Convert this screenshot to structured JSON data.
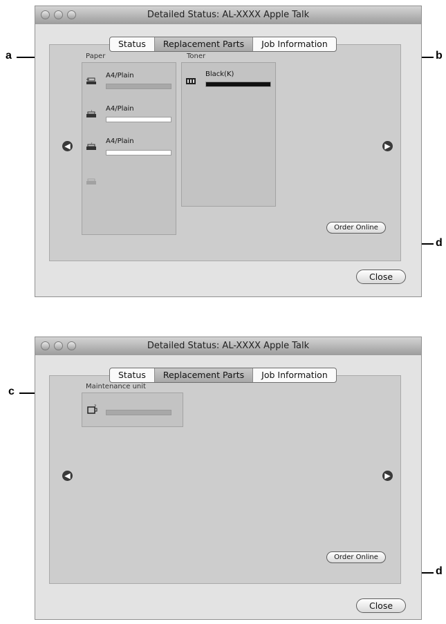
{
  "window1": {
    "title": "Detailed Status: AL-XXXX  Apple Talk",
    "tabs": [
      "Status",
      "Replacement Parts",
      "Job Information"
    ],
    "paper_label": "Paper",
    "toner_label": "Toner",
    "paper_items": [
      {
        "label": "A4/Plain",
        "level": 1.0
      },
      {
        "label": "A4/Plain",
        "level": 0.0
      },
      {
        "label": "A4/Plain",
        "level": 0.0
      }
    ],
    "toner_items": [
      {
        "label": "Black(K)",
        "level": 1.0,
        "color": "#111111"
      }
    ],
    "order_online_label": "Order Online",
    "close_label": "Close"
  },
  "window2": {
    "title": "Detailed Status: AL-XXXX  Apple Talk",
    "tabs": [
      "Status",
      "Replacement Parts",
      "Job Information"
    ],
    "maintenance_label": "Maintenance unit",
    "maintenance_level": 1.0,
    "order_online_label": "Order Online",
    "close_label": "Close"
  },
  "callouts": {
    "a": "a",
    "b": "b",
    "c": "c",
    "d": "d"
  },
  "colors": {
    "bar_fill_gray": "#a8a8a8",
    "toner_black": "#111111"
  }
}
